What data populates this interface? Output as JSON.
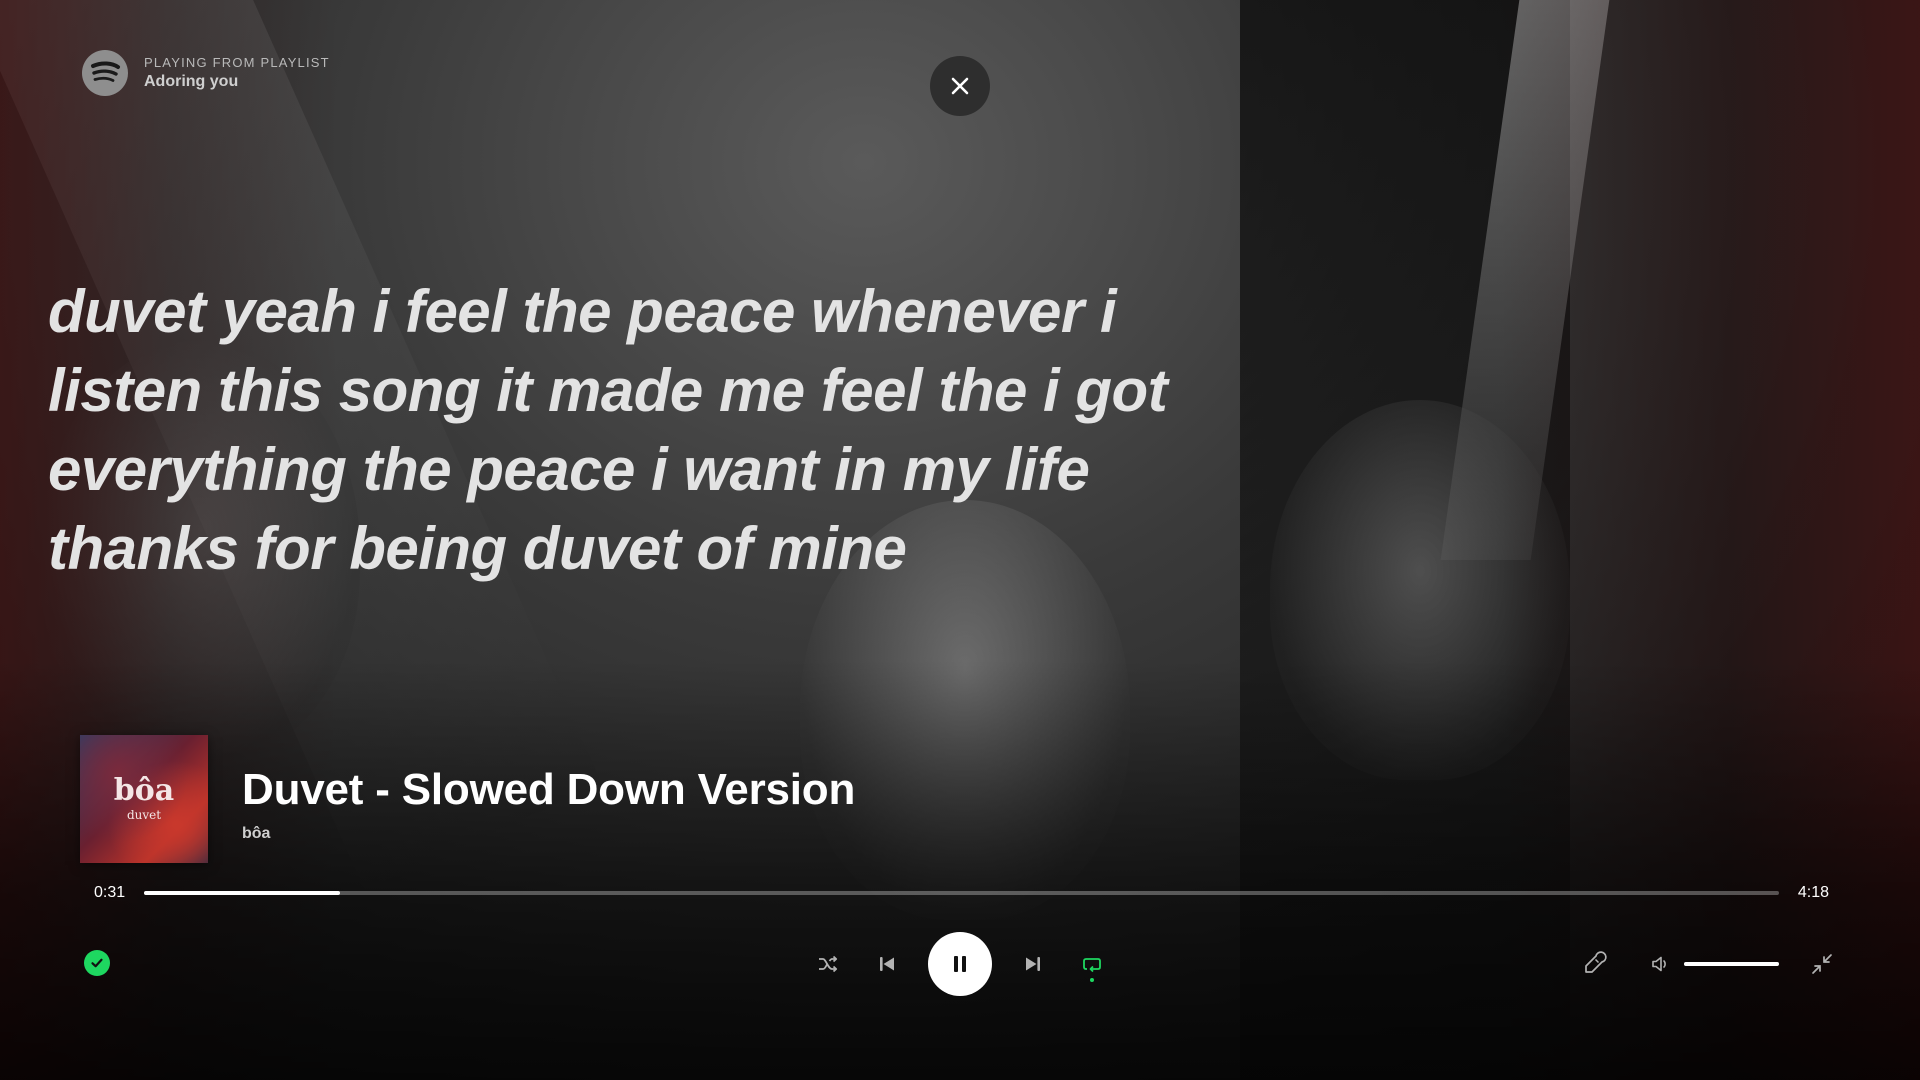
{
  "header": {
    "label": "PLAYING FROM PLAYLIST",
    "playlist_name": "Adoring you"
  },
  "lyrics": {
    "lines": [
      "duvet yeah i feel the peace whenever i",
      "listen this song it made me feel the i got",
      "everything the peace i want in my life",
      "thanks for being duvet of mine"
    ]
  },
  "now_playing": {
    "cover_title": "bôa",
    "cover_subtitle": "duvet",
    "title": "Duvet - Slowed Down Version",
    "artist": "bôa"
  },
  "progress": {
    "elapsed": "0:31",
    "duration": "4:18",
    "fraction": 0.12
  },
  "volume": {
    "level": 1.0
  },
  "icons": {
    "logo": "spotify-logo-icon",
    "close": "close-icon",
    "saved": "check-circle-icon",
    "shuffle": "shuffle-icon",
    "previous": "skip-previous-icon",
    "play_pause": "pause-icon",
    "next": "skip-next-icon",
    "repeat": "repeat-icon",
    "lyrics": "microphone-icon",
    "volume": "volume-icon",
    "exit_fullscreen": "minimize-icon"
  },
  "colors": {
    "accent": "#1ed760",
    "text": "#ffffff",
    "lyrics": "#e3e3e3"
  }
}
